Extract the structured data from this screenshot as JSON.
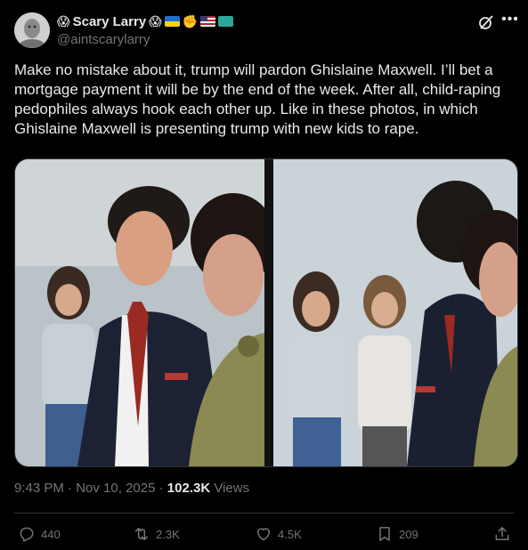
{
  "author": {
    "display_name": "Scary Larry",
    "handle": "@aintscarylarry",
    "name_emojis": [
      "😱",
      "😱"
    ]
  },
  "post": {
    "text": "Make no mistake about it, trump will pardon Ghislaine Maxwell. I’ll bet a mortgage payment it will be by the end of the week. After all, child-raping pedophiles always hook each other up. Like in these photos, in which Ghislaine Maxwell is presenting trump with new kids to rape.",
    "time": "9:43 PM",
    "date": "Nov 10, 2025",
    "separator": " · ",
    "views_count": "102.3K",
    "views_label": " Views"
  },
  "actions": {
    "replies": "440",
    "reposts": "2.3K",
    "likes": "4.5K",
    "bookmarks": "209"
  },
  "icons": [
    "avatar",
    "grok-icon",
    "more-icon",
    "reply-icon",
    "repost-icon",
    "like-icon",
    "bookmark-icon",
    "share-icon"
  ],
  "colors": {
    "background": "#000000",
    "text": "#e7e9ea",
    "muted": "#71767b",
    "border": "#2f3336"
  }
}
